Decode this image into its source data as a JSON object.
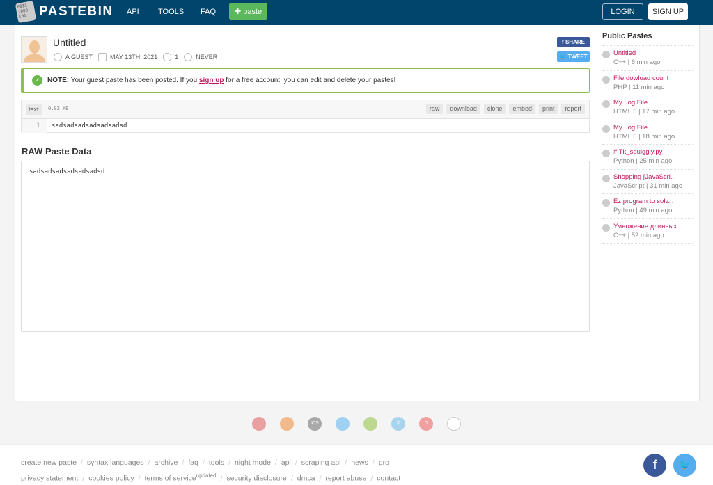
{
  "header": {
    "logo_text": "PASTEBIN",
    "logo_icon_text": "0011 1000 101",
    "nav": [
      "API",
      "TOOLS",
      "FAQ"
    ],
    "paste_button": "paste",
    "login": "LOGIN",
    "signup": "SIGN UP"
  },
  "paste": {
    "title": "Untitled",
    "author": "A GUEST",
    "date": "MAY 13TH, 2021",
    "views": "1",
    "expires": "NEVER",
    "share_label": "SHARE",
    "tweet_label": "TWEET"
  },
  "note": {
    "bold": "NOTE:",
    "text1": " Your guest paste has been posted. If you ",
    "link": "sign up",
    "text2": " for a free account, you can edit and delete your pastes!"
  },
  "code": {
    "language": "text",
    "size": "0.02 KB",
    "actions": [
      "raw",
      "download",
      "clone",
      "embed",
      "print",
      "report"
    ],
    "lines": [
      {
        "num": "1.",
        "content": "sadsadsadsadsadsadsd"
      }
    ]
  },
  "raw": {
    "heading": "RAW Paste Data",
    "content": "sadsadsadsadsadsadsd"
  },
  "sidebar": {
    "heading": "Public Pastes",
    "items": [
      {
        "title": "Untitled",
        "sub": "C++ | 6 min ago"
      },
      {
        "title": "File dowload count",
        "sub": "PHP | 11 min ago"
      },
      {
        "title": "My Log File",
        "sub": "HTML 5 | 17 min ago"
      },
      {
        "title": "My Log File",
        "sub": "HTML 5 | 18 min ago"
      },
      {
        "title": "# Tk_squiggly.py",
        "sub": "Python | 25 min ago"
      },
      {
        "title": "Shopping [JavaScri...",
        "sub": "JavaScript | 31 min ago"
      },
      {
        "title": "Ez program to solv...",
        "sub": "Python | 49 min ago"
      },
      {
        "title": "Умножение длинных",
        "sub": "C++ | 52 min ago"
      }
    ]
  },
  "browsers": [
    {
      "name": "chrome",
      "label": "",
      "color": "#e8a0a0"
    },
    {
      "name": "firefox",
      "label": "",
      "color": "#f2b98a"
    },
    {
      "name": "ios",
      "label": "iOS",
      "color": "#a9a9a9"
    },
    {
      "name": "windows",
      "label": "",
      "color": "#9fd2f2"
    },
    {
      "name": "android",
      "label": "",
      "color": "#bcd98f"
    },
    {
      "name": "macos",
      "label": "X",
      "color": "#a9d4ee"
    },
    {
      "name": "opera",
      "label": "0",
      "color": "#f0a0a0"
    },
    {
      "name": "linux",
      "label": "",
      "color": "#ffffff"
    }
  ],
  "footer": {
    "row1": [
      "create new paste",
      "syntax languages",
      "archive",
      "faq",
      "tools",
      "night mode",
      "api",
      "scraping api",
      "news",
      "pro"
    ],
    "row2": [
      "privacy statement",
      "cookies policy",
      "terms of service",
      "security disclosure",
      "dmca",
      "report abuse",
      "contact"
    ],
    "updated_badge": "updated",
    "facebook": "f",
    "twitter": "🐦"
  }
}
